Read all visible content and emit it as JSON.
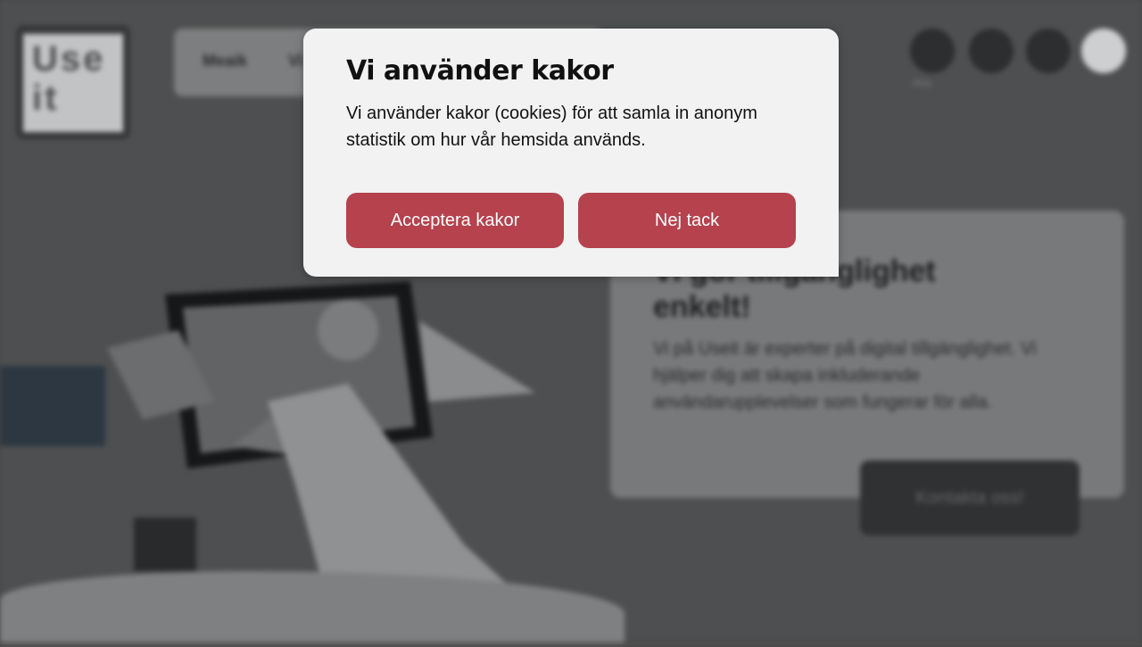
{
  "colors": {
    "button_bg": "#b5424d",
    "dialog_bg": "#f2f2f2",
    "backdrop": "#4b4b4b"
  },
  "background_page": {
    "logo_text": "Use it",
    "nav": [
      "Meaik",
      "Vi"
    ],
    "tool_icons": [
      "flag-icon",
      "globe-icon",
      "menu-icon",
      "phone-icon"
    ],
    "tool_label": "Alla",
    "card": {
      "title": "Vi gör tillgänglighet enkelt!",
      "text": "Vi på Useit är experter på digital tillgänglighet. Vi hjälper dig att skapa inkluderande användarupplevelser som fungerar för alla.",
      "button_label": "Kontakta oss!"
    }
  },
  "cookie_dialog": {
    "title": "Vi använder kakor",
    "text": "Vi använder kakor (cookies) för att samla in anonym statistik om hur vår hemsida används.",
    "accept_label": "Acceptera kakor",
    "decline_label": "Nej tack"
  }
}
